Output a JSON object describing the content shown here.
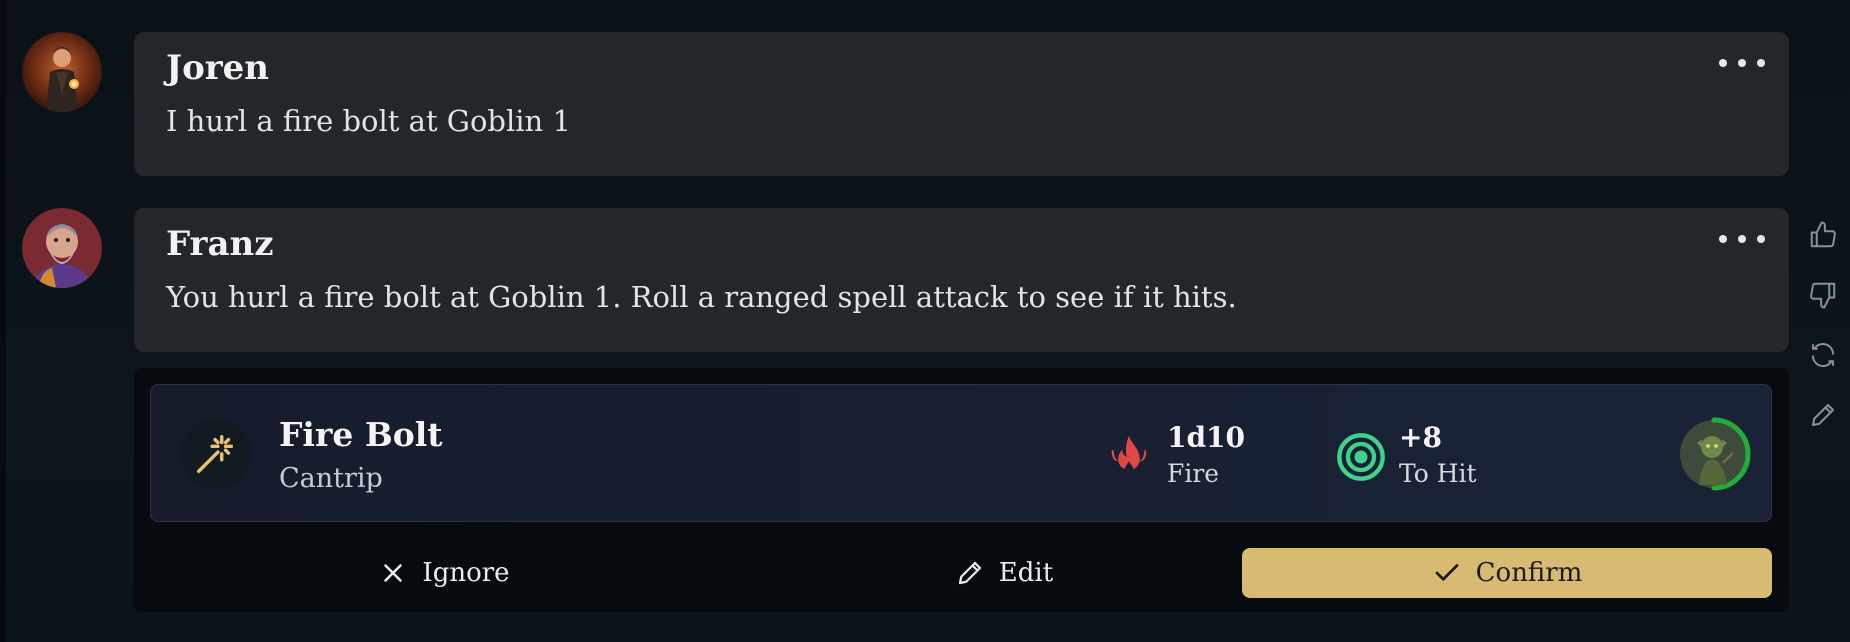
{
  "messages": [
    {
      "author": "Joren",
      "text": "I hurl a fire bolt at Goblin 1",
      "avatar_icon": "wizard-avatar",
      "menu_icon": "more-horizontal-icon"
    },
    {
      "author": "Franz",
      "text": "You hurl a fire bolt at Goblin 1. Roll a ranged spell attack to see if it hits.",
      "avatar_icon": "bearded-man-avatar",
      "menu_icon": "more-horizontal-icon"
    }
  ],
  "side_actions": [
    "thumbs-up-icon",
    "thumbs-down-icon",
    "regenerate-icon",
    "edit-pencil-icon"
  ],
  "spell_card": {
    "icon": "magic-wand-icon",
    "name": "Fire Bolt",
    "level": "Cantrip",
    "damage": {
      "icon": "fire-icon",
      "value": "1d10",
      "label": "Fire"
    },
    "to_hit": {
      "icon": "target-icon",
      "value": "+8",
      "label": "To Hit"
    },
    "target": {
      "icon": "goblin-avatar",
      "health_fraction": 0.5
    }
  },
  "actions": {
    "ignore_label": "Ignore",
    "edit_label": "Edit",
    "confirm_label": "Confirm"
  },
  "colors": {
    "accent": "#d9ba72",
    "fire": "#e04848",
    "target": "#3fd28a",
    "health": "#1fae3a",
    "wand": "#e7c46b"
  }
}
